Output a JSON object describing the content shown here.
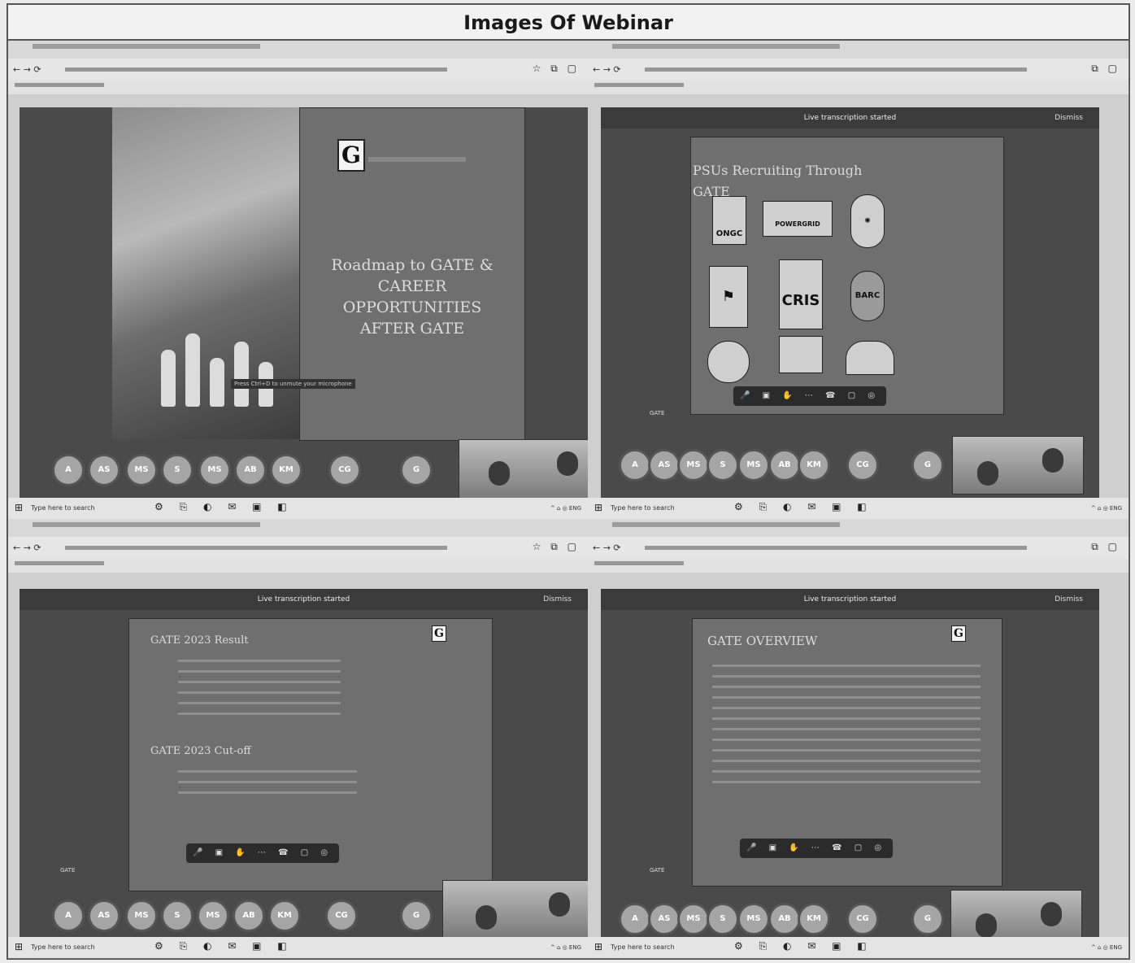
{
  "title": "Images Of Webinar",
  "shots": [
    {
      "slide1": {
        "logo": "G",
        "title_lines": [
          "Roadmap to GATE &",
          "CAREER OPPORTUNITIES",
          "AFTER GATE"
        ]
      },
      "participants": [
        "AS",
        "MS",
        "S",
        "MS",
        "AB",
        "KM",
        "CG",
        "G"
      ],
      "taskbar_search": "Type here to search"
    },
    {
      "banner": "Live transcription started",
      "dismiss": "Dismiss",
      "slide_title": "PSUs Recruiting Through GATE",
      "logos": [
        "ONGC",
        "POWERGRID",
        "CRIS",
        "BARC"
      ],
      "participants": [
        "AS",
        "MS",
        "S",
        "MS",
        "AB",
        "KM",
        "CG",
        "G"
      ],
      "taskbar_search": "Type here to search"
    },
    {
      "banner": "Live transcription started",
      "dismiss": "Dismiss",
      "slide_logo": "G",
      "heading1": "GATE 2023 Result",
      "heading2": "GATE 2023 Cut-off",
      "participants": [
        "AS",
        "MS",
        "S",
        "MS",
        "AB",
        "KM",
        "CG",
        "G"
      ],
      "taskbar_search": "Type here to search"
    },
    {
      "banner": "Live transcription started",
      "dismiss": "Dismiss",
      "slide_logo": "G",
      "heading": "GATE OVERVIEW",
      "participants": [
        "AS",
        "MS",
        "S",
        "MS",
        "AB",
        "KM",
        "CG",
        "G"
      ],
      "taskbar_search": "Type here to search"
    }
  ],
  "colors": {
    "meeting_bg": "#4a4a4a",
    "slide_bg": "#6f6f6f",
    "taskbar": "#e4e4e4"
  }
}
